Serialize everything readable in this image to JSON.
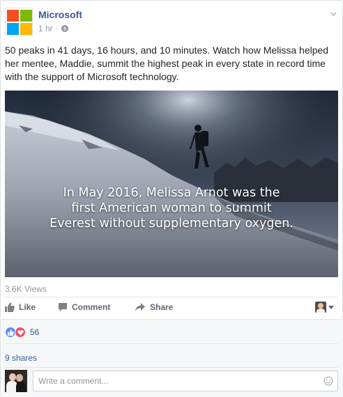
{
  "post": {
    "page_name": "Microsoft",
    "timestamp": "1 hr",
    "separator": "·",
    "text": "50 peaks in 41 days, 16 hours, and 10 minutes. Watch how Melissa helped her mentee, Maddie, summit the highest peak in every state in record time with the support of Microsoft technology."
  },
  "video": {
    "caption_lines": [
      "In May 2016, Melissa Arnot was the",
      "first American woman to summit",
      "Everest without supplementary oxygen."
    ]
  },
  "views": "3.6K Views",
  "actions": {
    "like": "Like",
    "comment": "Comment",
    "share": "Share"
  },
  "reactions": {
    "count": "56",
    "types": [
      "like-icon",
      "love-icon"
    ]
  },
  "shares": "9 shares",
  "comment_box": {
    "placeholder": "Write a comment..."
  },
  "colors": {
    "link_blue": "#365899",
    "muted_gray": "#90949c",
    "ms_red": "#f25022",
    "ms_green": "#7fba00",
    "ms_blue": "#00a4ef",
    "ms_yellow": "#ffb900",
    "like_blue": "#5890ff",
    "love_red": "#f25268"
  }
}
